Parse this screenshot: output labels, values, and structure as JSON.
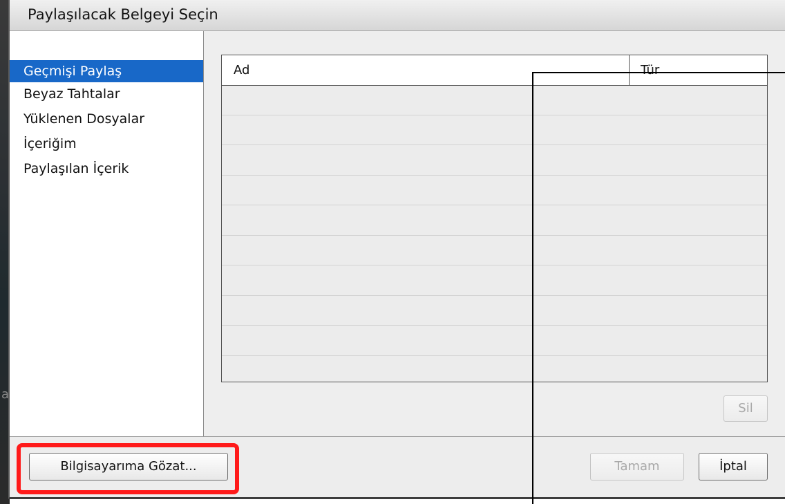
{
  "dialog": {
    "title": "Paylaşılacak Belgeyi Seçin"
  },
  "sidebar": {
    "items": [
      {
        "label": "Geçmişi Paylaş",
        "active": true
      },
      {
        "label": "Beyaz Tahtalar",
        "active": false
      },
      {
        "label": "Yüklenen Dosyalar",
        "active": false
      },
      {
        "label": "İçeriğim",
        "active": false
      },
      {
        "label": "Paylaşılan İçerik",
        "active": false
      }
    ]
  },
  "table": {
    "columns": [
      "Ad",
      "Tür"
    ],
    "rows": []
  },
  "buttons": {
    "delete": "Sil",
    "browse": "Bilgisayarıma Gözat...",
    "ok": "Tamam",
    "cancel": "İptal"
  },
  "colors": {
    "selection": "#1868c8",
    "highlight": "#ff1a1a"
  }
}
